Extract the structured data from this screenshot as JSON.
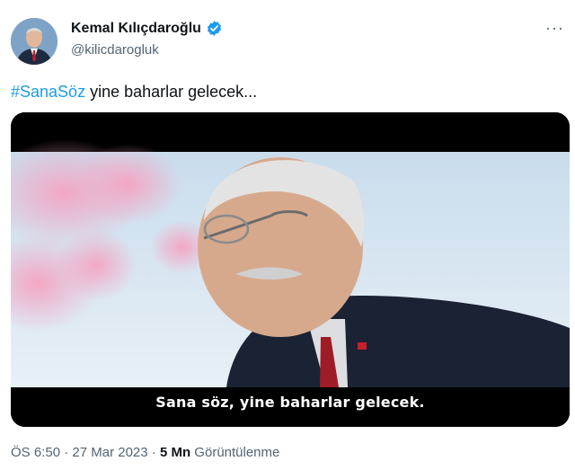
{
  "author": {
    "display_name": "Kemal Kılıçdaroğlu",
    "handle": "@kilicdarogluk",
    "verified_icon": "verified-badge-icon",
    "avatar_icon": "profile-avatar"
  },
  "more_menu": {
    "label": "···"
  },
  "tweet": {
    "hashtag": "#SanaSöz",
    "text": " yine baharlar gelecek..."
  },
  "media": {
    "subtitle": "Sana söz, yine baharlar gelecek."
  },
  "meta": {
    "time": "ÖS 6:50",
    "separator": " · ",
    "date": "27 Mar 2023",
    "views_count": "5 Mn",
    "views_label": " Görüntülenme"
  },
  "colors": {
    "accent": "#1d9bf0",
    "secondary_text": "#536471"
  }
}
